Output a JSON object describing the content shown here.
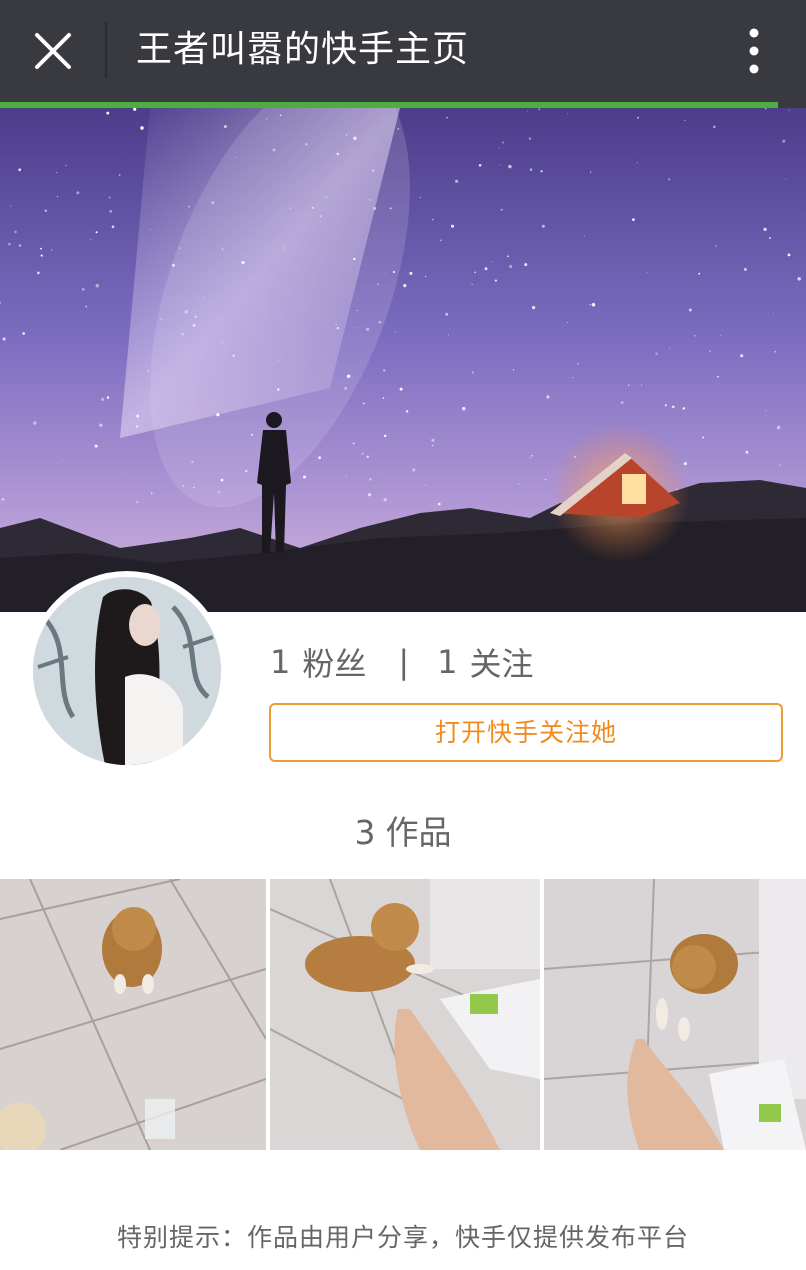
{
  "header": {
    "title": "王者叫嚣的快手主页",
    "close_icon": "close-icon",
    "more_icon": "more-vertical-icon",
    "load_progress": 0.965,
    "progress_color": "#4aaf3c",
    "bar_color": "#393a3f"
  },
  "profile": {
    "banner_image": "night-sky-milky-way-with-person-and-lit-cabin",
    "avatar_image": "woman-long-dark-hair-against-graffiti-wall",
    "fans_count": "1",
    "fans_label": "粉丝",
    "separator": "|",
    "following_count": "1",
    "following_label": "关注",
    "follow_button_label": "打开快手关注她",
    "accent_color": "#f08c1e"
  },
  "works": {
    "count": "3",
    "label": "作品",
    "items": [
      {
        "image": "puppy-on-tile-floor"
      },
      {
        "image": "puppy-lying-with-hand"
      },
      {
        "image": "puppy-sitting-near-hand"
      }
    ]
  },
  "footer": {
    "notice": "特别提示：作品由用户分享，快手仅提供发布平台"
  }
}
